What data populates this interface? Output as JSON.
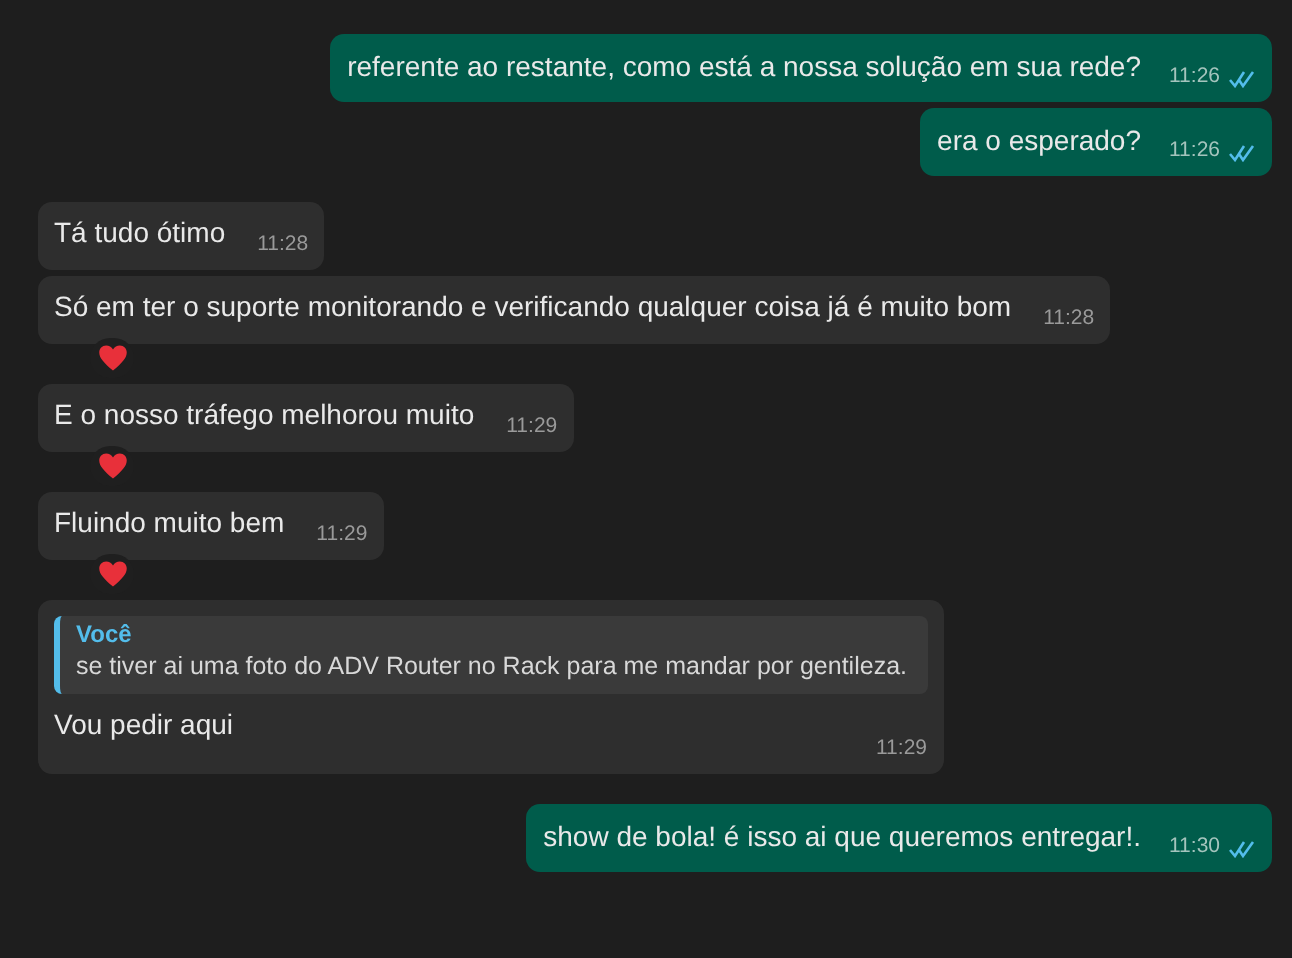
{
  "messages": [
    {
      "kind": "outgoing",
      "text": "referente ao restante, como está a nossa solução em sua rede?",
      "time": "11:26",
      "read": true
    },
    {
      "kind": "outgoing",
      "text": "era o esperado?",
      "time": "11:26",
      "read": true
    },
    {
      "kind": "incoming",
      "text": "Tá tudo ótimo",
      "time": "11:28",
      "reaction": false
    },
    {
      "kind": "incoming",
      "text": "Só em ter o suporte monitorando e verificando qualquer coisa já é muito bom",
      "time": "11:28",
      "reaction": true
    },
    {
      "kind": "incoming",
      "text": "E o nosso tráfego melhorou muito",
      "time": "11:29",
      "reaction": true
    },
    {
      "kind": "incoming",
      "text": "Fluindo muito bem",
      "time": "11:29",
      "reaction": true
    },
    {
      "kind": "quoted",
      "quote_author": "Você",
      "quote_text": "se tiver ai uma foto do ADV Router no Rack para me mandar por gentileza.",
      "text": "Vou pedir aqui",
      "time": "11:29",
      "reaction": false
    },
    {
      "kind": "outgoing",
      "text": "show de bola! é isso ai que queremos entregar!.",
      "time": "11:30",
      "read": true
    }
  ]
}
